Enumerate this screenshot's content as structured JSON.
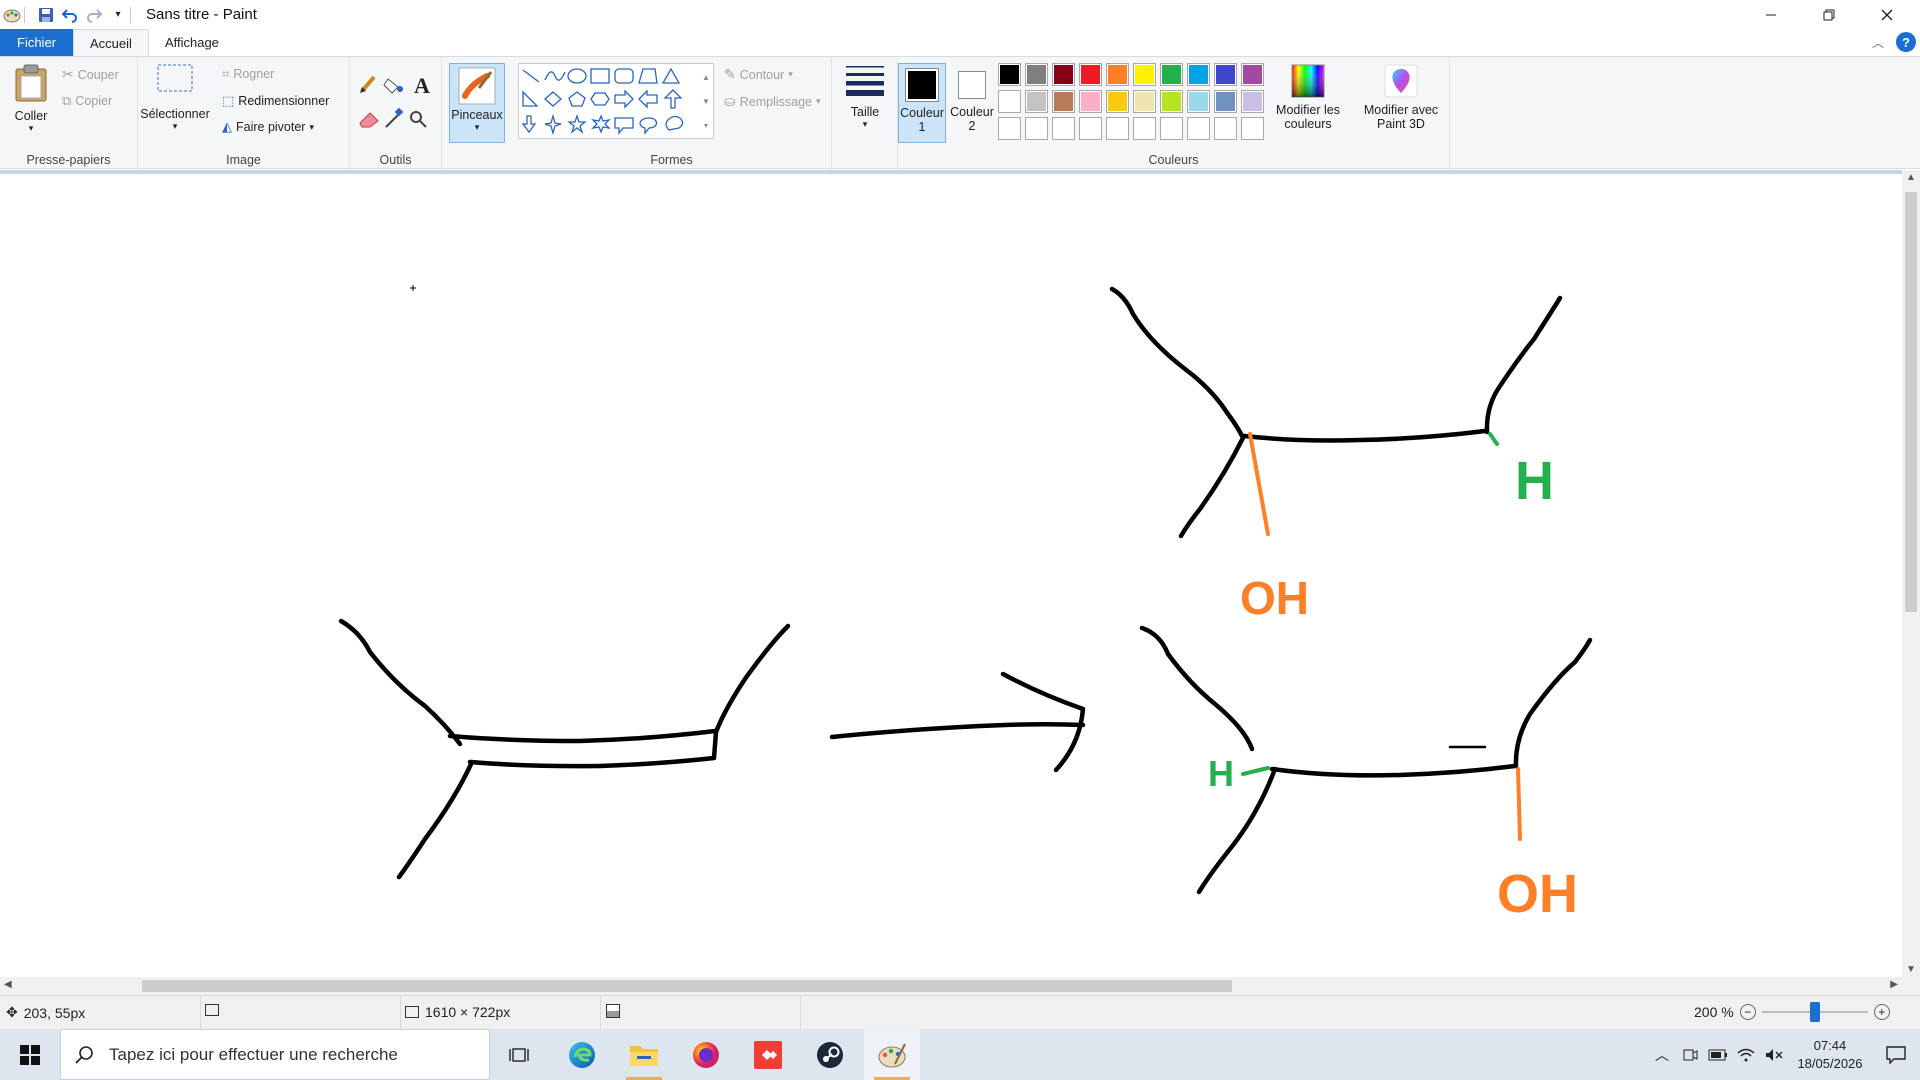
{
  "app": {
    "title": "Sans titre - Paint"
  },
  "tabs": [
    {
      "label": "Fichier"
    },
    {
      "label": "Accueil"
    },
    {
      "label": "Affichage"
    }
  ],
  "ribbon": {
    "clipboard": {
      "paste": "Coller",
      "cut": "Couper",
      "copy": "Copier",
      "group": "Presse-papiers"
    },
    "image": {
      "select": "Sélectionner",
      "crop": "Rogner",
      "resize": "Redimensionner",
      "rotate": "Faire pivoter",
      "group": "Image"
    },
    "tools": {
      "group": "Outils"
    },
    "brushes": {
      "label": "Pinceaux"
    },
    "shapes": {
      "outline": "Contour",
      "fill": "Remplissage",
      "group": "Formes"
    },
    "size": {
      "label": "Taille"
    },
    "colors": {
      "color1_line1": "Couleur",
      "color1_line2": "1",
      "color2_line1": "Couleur",
      "color2_line2": "2",
      "edit_line1": "Modifier les",
      "edit_line2": "couleurs",
      "paint3d_line1": "Modifier avec",
      "paint3d_line2": "Paint 3D",
      "group": "Couleurs",
      "color1": "#000000",
      "color2": "#ffffff",
      "palette_row1": [
        "#000000",
        "#7f7f7f",
        "#880015",
        "#ed1c24",
        "#ff7f27",
        "#fff200",
        "#22b14c",
        "#00a2e8",
        "#3f48cc",
        "#a349a4"
      ],
      "palette_row2": [
        "#ffffff",
        "#c3c3c3",
        "#b97a57",
        "#ffaec9",
        "#ffc90e",
        "#efe4b0",
        "#b5e61d",
        "#99d9ea",
        "#7092be",
        "#c8bfe7"
      ],
      "palette_row3": [
        "#ffffff",
        "#ffffff",
        "#ffffff",
        "#ffffff",
        "#ffffff",
        "#ffffff",
        "#ffffff",
        "#ffffff",
        "#ffffff",
        "#ffffff"
      ]
    }
  },
  "drawing": {
    "oh_top": "OH",
    "h_top": "H",
    "h_bottom": "H",
    "oh_bottom": "OH",
    "green": "#22b14c",
    "orange": "#ff7f27"
  },
  "status": {
    "cursor_pos": "203, 55px",
    "image_size": "1610 × 722px",
    "zoom": "200 %",
    "zoom_slider_fraction": 0.5
  },
  "taskbar": {
    "search_placeholder": "Tapez ici pour effectuer une recherche",
    "time": "07:44",
    "date": "18/05/2026"
  }
}
